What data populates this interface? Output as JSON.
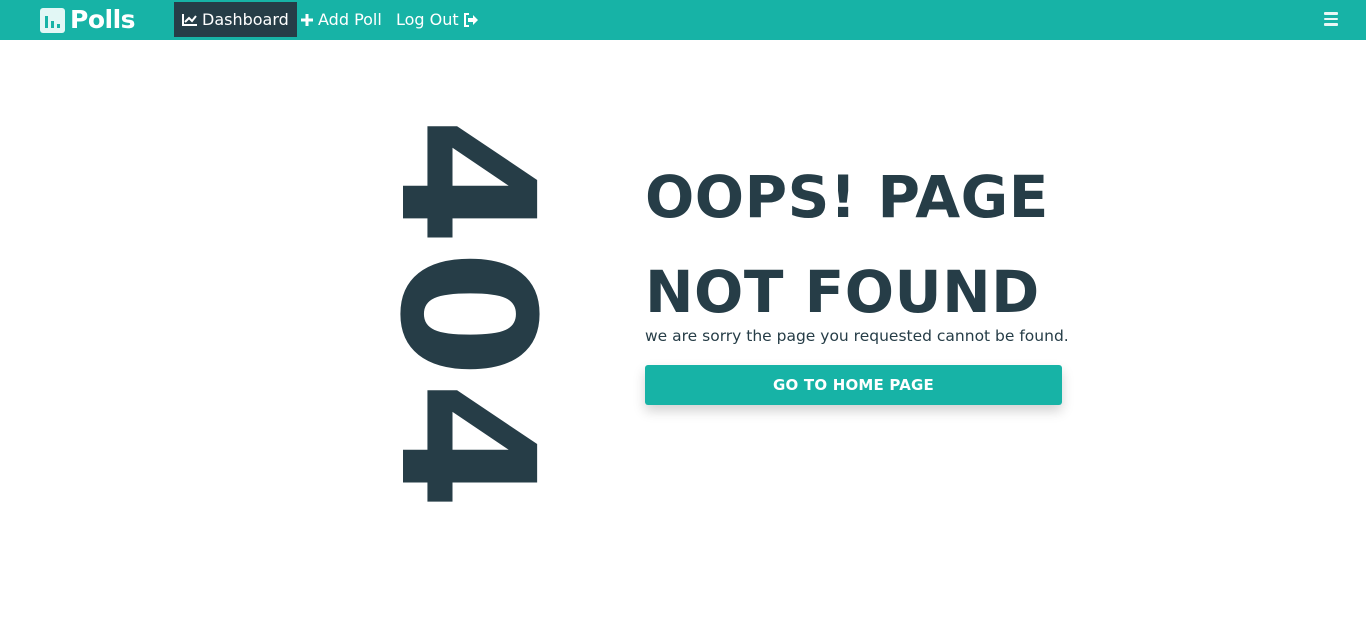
{
  "colors": {
    "primary": "#17b3a6",
    "dark": "#263d47",
    "background": "#ffffff"
  },
  "navbar": {
    "brand": {
      "icon": "bar-chart-icon",
      "text": "Polls"
    },
    "items": [
      {
        "label": "Dashboard",
        "icon": "line-chart-icon",
        "active": true
      },
      {
        "label": "Add Poll",
        "icon": "plus-icon",
        "active": false
      },
      {
        "label": "Log Out",
        "icon": "sign-out-icon",
        "active": false
      }
    ],
    "menu_toggle_icon": "hamburger-icon"
  },
  "error": {
    "code": "404",
    "heading_line1": "OOPS! PAGE",
    "heading_line2": "NOT FOUND",
    "message": "we are sorry the page you requested cannot be found.",
    "button_label": "GO TO HOME PAGE"
  }
}
